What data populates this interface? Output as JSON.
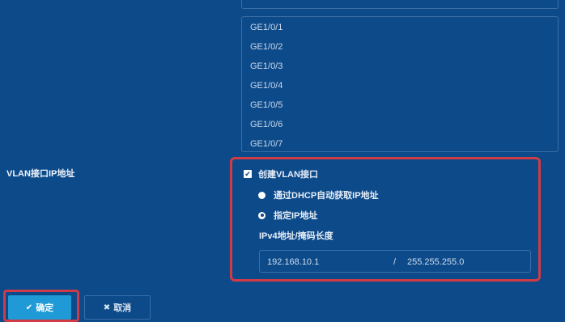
{
  "port_list": {
    "items": [
      "GE1/0/1",
      "GE1/0/2",
      "GE1/0/3",
      "GE1/0/4",
      "GE1/0/5",
      "GE1/0/6",
      "GE1/0/7"
    ]
  },
  "vlan_ip": {
    "label": "VLAN接口IP地址",
    "create_vlan_label": "创建VLAN接口",
    "dhcp_label": "通过DHCP自动获取IP地址",
    "static_label": "指定IP地址",
    "ipv4_label": "IPv4地址/掩码长度",
    "ip_value": "192.168.10.1",
    "separator": "/",
    "mask_value": "255.255.255.0"
  },
  "buttons": {
    "confirm_label": "确定",
    "cancel_label": "取消"
  },
  "colors": {
    "background": "#0d4a8a",
    "highlight": "#d13b46",
    "primary_button": "#1f9ad6"
  }
}
